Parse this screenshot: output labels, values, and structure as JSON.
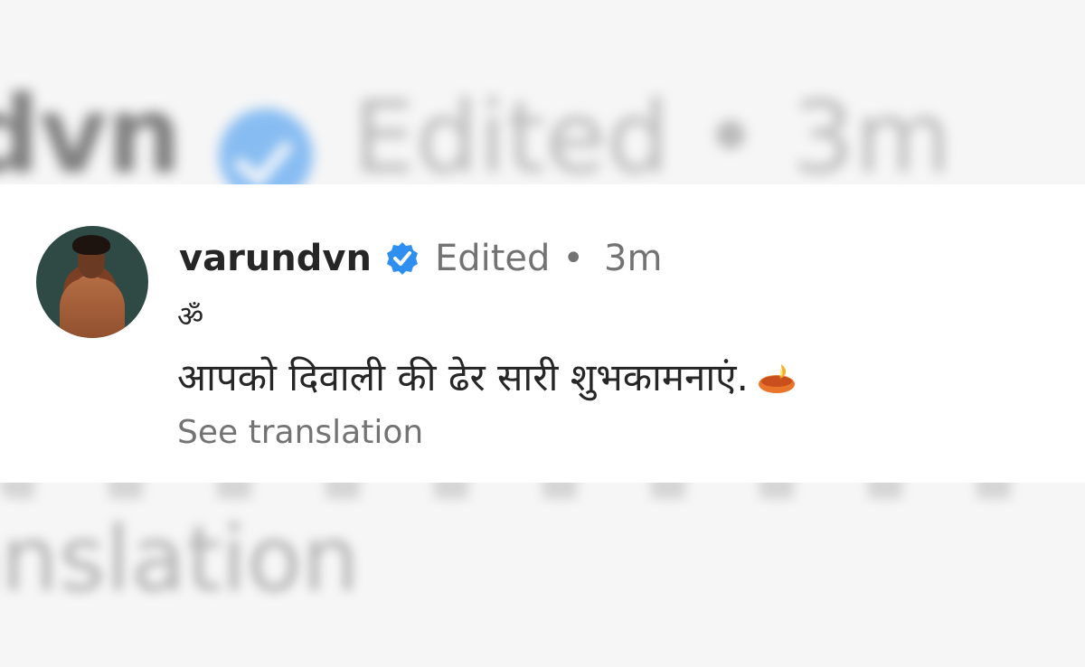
{
  "background": {
    "name_fragment": "dvn",
    "meta_fragment": "Edited  •   3m",
    "see_fragment": "anslation"
  },
  "comment": {
    "username": "varundvn",
    "edited_label": "Edited",
    "separator": "•",
    "timestamp": "3m",
    "om_symbol": "ॐ",
    "message": "आपको दिवाली की ढेर सारी शुभकामनाएं.",
    "see_translation_label": "See translation",
    "verified_icon": "verified-badge-icon",
    "emoji_icon": "diya-icon"
  },
  "colors": {
    "verified_blue": "#2f8ff0",
    "username_text": "#262626",
    "secondary_text": "#737373",
    "card_bg": "#ffffff"
  }
}
